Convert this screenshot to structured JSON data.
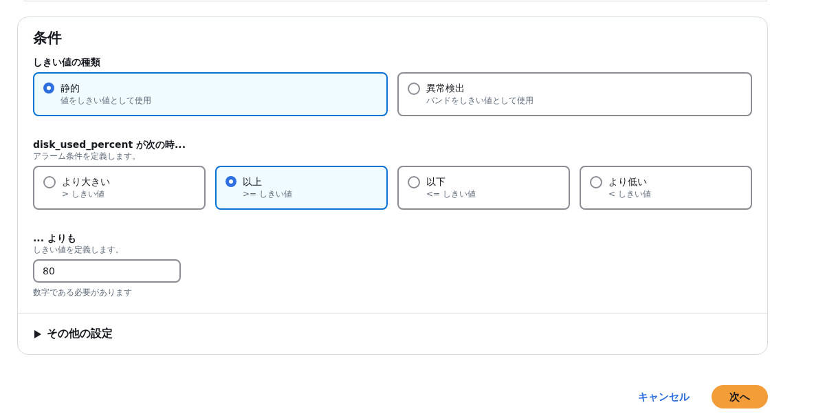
{
  "section": {
    "title": "条件",
    "threshold_type": {
      "label": "しきい値の種類",
      "options": [
        {
          "label": "静的",
          "description": "値をしきい値として使用",
          "selected": true
        },
        {
          "label": "異常検出",
          "description": "バンドをしきい値として使用",
          "selected": false
        }
      ]
    },
    "condition": {
      "label": "disk_used_percent が次の時...",
      "description": "アラーム条件を定義します。",
      "options": [
        {
          "label": "より大きい",
          "description": "> しきい値",
          "selected": false
        },
        {
          "label": "以上",
          "description": ">= しきい値",
          "selected": true
        },
        {
          "label": "以下",
          "description": "<= しきい値",
          "selected": false
        },
        {
          "label": "より低い",
          "description": "< しきい値",
          "selected": false
        }
      ]
    },
    "threshold": {
      "label": "... よりも",
      "description": "しきい値を定義します。",
      "value": "80",
      "hint": "数字である必要があります"
    },
    "additional_settings": {
      "label": "その他の設定",
      "expanded": false
    }
  },
  "actions": {
    "cancel": "キャンセル",
    "next": "次へ"
  }
}
